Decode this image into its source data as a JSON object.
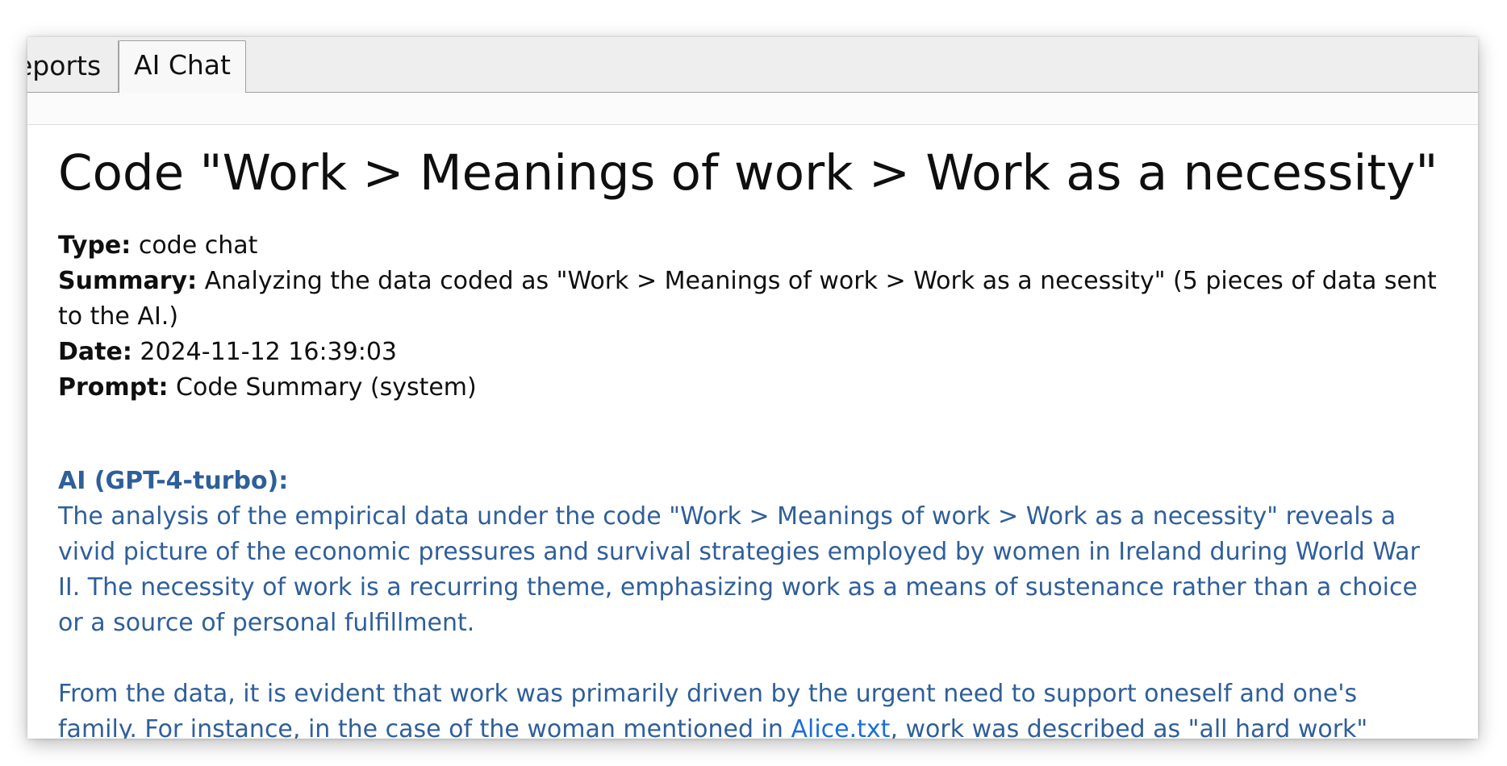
{
  "tabs": [
    {
      "label": "Reports",
      "visible_label": "eports",
      "active": false
    },
    {
      "label": "AI Chat",
      "active": true
    }
  ],
  "chat": {
    "title": "Code \"Work > Meanings of work > Work as a necessity\"",
    "type_label": "Type:",
    "type_value": "code chat",
    "summary_label": "Summary:",
    "summary_value": "Analyzing the data coded as \"Work > Meanings of work > Work as a necessity\" (5 pieces of data sent to the AI.)",
    "date_label": "Date:",
    "date_value": "2024-11-12 16:39:03",
    "prompt_label": "Prompt:",
    "prompt_value": "Code Summary (system)",
    "ai_label": "AI (GPT-4-turbo):",
    "paragraph1": "The analysis of the empirical data under the code \"Work > Meanings of work > Work as a necessity\" reveals a vivid picture of the economic pressures and survival strategies employed by women in Ireland during World War II. The necessity of work is a recurring theme, emphasizing work as a means of sustenance rather than a choice or a source of personal fulfillment.",
    "paragraph2_before": "From the data, it is evident that work was primarily driven by the urgent need to support oneself and one's family. For instance, in the case of the woman mentioned in ",
    "paragraph2_link": "Alice.txt",
    "paragraph2_after": ", work was described as \"all hard work\""
  },
  "colors": {
    "ai_text": "#2f5f9a",
    "link": "#1a6fd8",
    "text": "#0f0f0f"
  }
}
